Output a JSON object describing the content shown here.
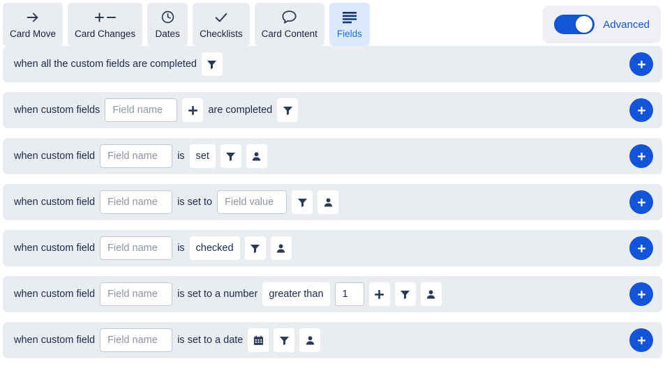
{
  "colors": {
    "row_bg": "#e9ecf1",
    "accent_blue": "#1355d8",
    "tab_active_bg": "#dbe8fe",
    "tab_active_text": "#1a73e8",
    "text_dark": "#1b2b4b",
    "placeholder": "#8d94a3"
  },
  "tabs": [
    {
      "label": "Card Move",
      "icon": "arrow-right-icon",
      "active": false
    },
    {
      "label": "Card Changes",
      "icon": "plus-minus-icon",
      "active": false
    },
    {
      "label": "Dates",
      "icon": "clock-icon",
      "active": false
    },
    {
      "label": "Checklists",
      "icon": "check-icon",
      "active": false
    },
    {
      "label": "Card Content",
      "icon": "speech-bubble-icon",
      "active": false
    },
    {
      "label": "Fields",
      "icon": "list-lines-icon",
      "active": true
    }
  ],
  "advanced": {
    "label": "Advanced",
    "toggle_on": true,
    "toggle_icon": "toggle-switch-icon"
  },
  "add_button": {
    "icon": "plus-icon",
    "label": "+"
  },
  "rows": [
    {
      "id": "all-custom-fields-completed",
      "parts": [
        {
          "kind": "text",
          "value": "when all the custom fields are completed"
        },
        {
          "kind": "icon",
          "icon": "filter-icon"
        }
      ]
    },
    {
      "id": "custom-fields-are-completed",
      "parts": [
        {
          "kind": "text",
          "value": "when custom fields"
        },
        {
          "kind": "input",
          "placeholder": "Field name",
          "value": "",
          "width": "w-fieldname"
        },
        {
          "kind": "icon",
          "icon": "plus-icon"
        },
        {
          "kind": "text",
          "value": "are completed"
        },
        {
          "kind": "icon",
          "icon": "filter-icon"
        }
      ]
    },
    {
      "id": "custom-field-is-set",
      "parts": [
        {
          "kind": "text",
          "value": "when custom field"
        },
        {
          "kind": "input",
          "placeholder": "Field name",
          "value": "",
          "width": "w-fieldname"
        },
        {
          "kind": "text",
          "value": "is"
        },
        {
          "kind": "option",
          "value": "set"
        },
        {
          "kind": "icon",
          "icon": "filter-icon"
        },
        {
          "kind": "icon",
          "icon": "person-icon"
        }
      ]
    },
    {
      "id": "custom-field-is-set-to-value",
      "parts": [
        {
          "kind": "text",
          "value": "when custom field"
        },
        {
          "kind": "input",
          "placeholder": "Field name",
          "value": "",
          "width": "w-fieldname"
        },
        {
          "kind": "text",
          "value": "is set to"
        },
        {
          "kind": "input",
          "placeholder": "Field value",
          "value": "",
          "width": "w-fieldvalue"
        },
        {
          "kind": "icon",
          "icon": "filter-icon"
        },
        {
          "kind": "icon",
          "icon": "person-icon"
        }
      ]
    },
    {
      "id": "custom-field-is-checked",
      "parts": [
        {
          "kind": "text",
          "value": "when custom field"
        },
        {
          "kind": "input",
          "placeholder": "Field name",
          "value": "",
          "width": "w-fieldname"
        },
        {
          "kind": "text",
          "value": "is"
        },
        {
          "kind": "option",
          "value": "checked"
        },
        {
          "kind": "icon",
          "icon": "filter-icon"
        },
        {
          "kind": "icon",
          "icon": "person-icon"
        }
      ]
    },
    {
      "id": "custom-field-is-set-to-number",
      "parts": [
        {
          "kind": "text",
          "value": "when custom field"
        },
        {
          "kind": "input",
          "placeholder": "Field name",
          "value": "",
          "width": "w-fieldname"
        },
        {
          "kind": "text",
          "value": "is set to a number"
        },
        {
          "kind": "option",
          "value": "greater than"
        },
        {
          "kind": "input",
          "placeholder": "",
          "value": "1",
          "width": "w-num"
        },
        {
          "kind": "icon",
          "icon": "plus-icon"
        },
        {
          "kind": "icon",
          "icon": "filter-icon"
        },
        {
          "kind": "icon",
          "icon": "person-icon"
        }
      ]
    },
    {
      "id": "custom-field-is-set-to-date",
      "parts": [
        {
          "kind": "text",
          "value": "when custom field"
        },
        {
          "kind": "input",
          "placeholder": "Field name",
          "value": "",
          "width": "w-fieldname"
        },
        {
          "kind": "text",
          "value": "is set to a date"
        },
        {
          "kind": "icon",
          "icon": "calendar-icon"
        },
        {
          "kind": "icon",
          "icon": "filter-icon"
        },
        {
          "kind": "icon",
          "icon": "person-icon"
        }
      ]
    }
  ]
}
